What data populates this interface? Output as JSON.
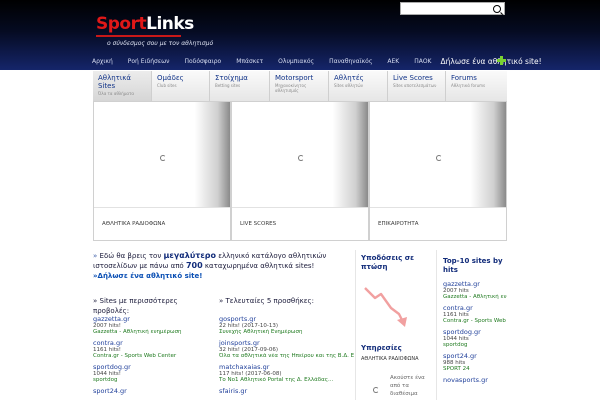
{
  "header": {
    "logo_part1": "Sport",
    "logo_part2": "Links",
    "slogan": "ο σύνδεσμος σου με τον αθλητισμό",
    "nav": [
      "Αρχική",
      "Ροή Ειδήσεων",
      "Ποδόσφαιρο",
      "Μπάσκετ",
      "Ολυμπιακός",
      "Παναθηναϊκός",
      "ΑΕΚ",
      "ΠΑΟΚ"
    ],
    "declare": "Δήλωσε ένα αθλητικό site!"
  },
  "tabs": [
    {
      "title": "Αθλητικά Sites",
      "sub": "Όλα τα αθλήματα",
      "active": true
    },
    {
      "title": "Ομάδες",
      "sub": "Club sites",
      "active": false
    },
    {
      "title": "Στοίχημα",
      "sub": "Betting sites",
      "active": false
    },
    {
      "title": "Motorsport",
      "sub": "Μηχανοκίνητος αθλητισμός",
      "active": false
    },
    {
      "title": "Αθλητές",
      "sub": "Sites αθλητών",
      "active": false
    },
    {
      "title": "Live Scores",
      "sub": "Sites αποτελεσμάτων",
      "active": false
    },
    {
      "title": "Forums",
      "sub": "Αθλητικά forums",
      "active": false
    }
  ],
  "sliders": [
    "ΑΘΛΗΤΙΚΑ ΡΑΔΙΟΦΩΝΑ",
    "LIVE SCORES",
    "ΕΠΙΚΑΙΡΟΤΗΤΑ"
  ],
  "intro": {
    "raquo": "»",
    "part1": " Εδώ θα βρεις τον ",
    "highlight": "μεγαλύτερο",
    "part2": " ελληνικό κατάλογο αθλητικών ιστοσελίδων με πάνω από ",
    "count": "700",
    "part3": " καταχωρημένα αθλητικά sites!",
    "cta": "»Δήλωσε ένα αθλητικό site!"
  },
  "popular": {
    "title": "» Sites με περισσότερες προβολές:",
    "items": [
      {
        "name": "gazzetta.gr",
        "hits": "2007 hits!",
        "desc": "Gazzetta - Αθλητική ενημέρωση"
      },
      {
        "name": "contra.gr",
        "hits": "1161 hits!",
        "desc": "Contra.gr - Sports Web Center"
      },
      {
        "name": "sportdog.gr",
        "hits": "1044 hits!",
        "desc": "sportdog"
      },
      {
        "name": "sport24.gr",
        "hits": "",
        "desc": ""
      }
    ]
  },
  "latest": {
    "title": "» Τελευταίες 5 προσθήκες:",
    "items": [
      {
        "name": "gosports.gr",
        "hits": "22 hits! (2017-10-13)",
        "desc": "Συνεχής Αθλητική Ενημέρωση"
      },
      {
        "name": "joinsports.gr",
        "hits": "32 hits! (2017-09-06)",
        "desc": "Όλα τα αθλητικά νέα της Ηπείρου και της Β.Δ. ΕΛΛΑΔΑΣ..."
      },
      {
        "name": "matchaxaias.gr",
        "hits": "117 hits! (2017-06-08)",
        "desc": "Το Νο1 Αθλητικό Portal της Δ. Ελλάδας..."
      },
      {
        "name": "sfairis.gr",
        "hits": "",
        "desc": ""
      }
    ]
  },
  "middle": {
    "title": "Υποδόσεις σε πτώση",
    "services_title": "Υπηρεσίες",
    "service_name": "ΑΘΛΗΤΙΚΑ ΡΑΔΙΟΦΩΝΑ",
    "service_text": "Ακούστε ένα από τα διαθέσιμα"
  },
  "top10": {
    "title": "Top-10 sites by hits",
    "items": [
      {
        "name": "gazzetta.gr",
        "hits": "2007 hits",
        "desc": "Gazzetta - Αθλητική ενη..."
      },
      {
        "name": "contra.gr",
        "hits": "1161 hits",
        "desc": "Contra.gr - Sports Web"
      },
      {
        "name": "sportdog.gr",
        "hits": "1044 hits",
        "desc": "sportdog"
      },
      {
        "name": "sport24.gr",
        "hits": "988 hits",
        "desc": "SPORT 24"
      },
      {
        "name": "novasports.gr",
        "hits": "",
        "desc": ""
      }
    ]
  },
  "colors": {
    "brand_red": "#e01818",
    "header_blue": "#15256a",
    "link_blue": "#1f3f9a",
    "accent_green": "#7ad232"
  }
}
